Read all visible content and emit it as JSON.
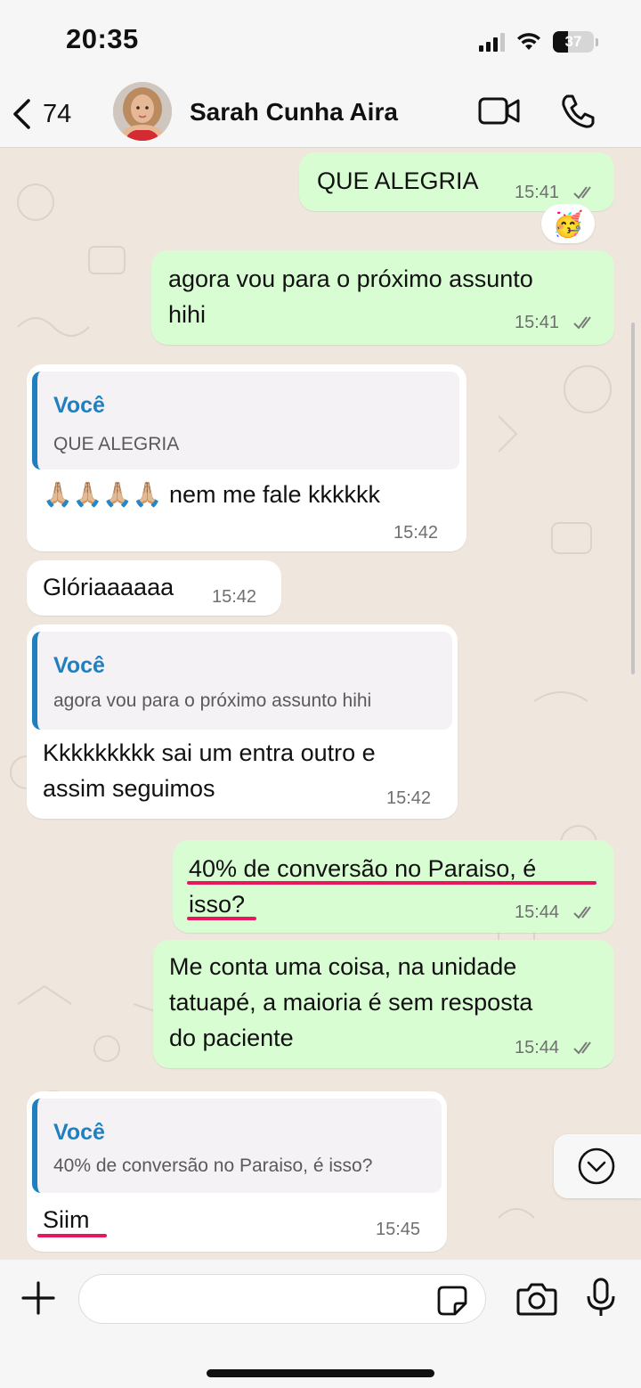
{
  "status_bar": {
    "time": "20:35",
    "battery_level": "37",
    "battery_fraction": 0.37,
    "icons": [
      "signal-icon",
      "wifi-icon",
      "battery-icon"
    ]
  },
  "header": {
    "back_count": "74",
    "contact_name": "Sarah Cunha Aira",
    "icons": [
      "back-chevron-icon",
      "avatar",
      "video-camera-icon",
      "phone-icon"
    ]
  },
  "messages": [
    {
      "direction": "out",
      "text": "QUE ALEGRIA",
      "time": "15:41",
      "status": "read",
      "reaction": "🥳"
    },
    {
      "direction": "out",
      "text_lines": [
        "agora vou para o próximo assunto",
        "hihi"
      ],
      "time": "15:41",
      "status": "read"
    },
    {
      "direction": "in",
      "quote_author": "Você",
      "quote_text": "QUE ALEGRIA",
      "text": "🙏🏼🙏🏼🙏🏼🙏🏼 nem me fale kkkkkk",
      "time": "15:42"
    },
    {
      "direction": "in",
      "text": "Glóriaaaaaa",
      "time": "15:42"
    },
    {
      "direction": "in",
      "quote_author": "Você",
      "quote_text": "agora vou para o próximo assunto hihi",
      "text_lines": [
        "Kkkkkkkkk sai um entra outro e",
        "assim seguimos"
      ],
      "time": "15:42"
    },
    {
      "direction": "out",
      "text_lines": [
        "40% de conversão no Paraiso, é",
        "isso?"
      ],
      "time": "15:44",
      "status": "read",
      "highlighted": true
    },
    {
      "direction": "out",
      "text_lines": [
        "Me conta uma coisa, na unidade",
        "tatuapé, a maioria é sem resposta",
        "do paciente"
      ],
      "time": "15:44",
      "status": "read"
    },
    {
      "direction": "in",
      "quote_author": "Você",
      "quote_text": "40% de conversão no Paraiso, é isso?",
      "text": "Siim",
      "time": "15:45",
      "highlighted": true
    }
  ],
  "input_bar": {
    "placeholder": "",
    "icons": [
      "plus-icon",
      "sticker-icon",
      "camera-icon",
      "microphone-icon"
    ]
  },
  "colors": {
    "outgoing_bubble": "#d9fdd3",
    "incoming_bubble": "#ffffff",
    "quote_accent": "#1f7fbf",
    "highlight_underline": "#e8175d",
    "wallpaper": "#efe7de"
  }
}
